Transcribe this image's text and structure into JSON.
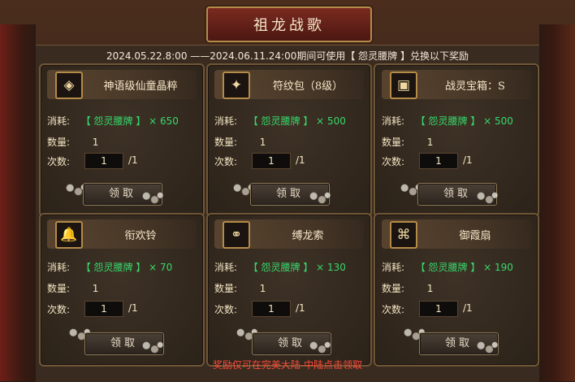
{
  "title": "祖龙战歌",
  "period_text": "2024.05.22.8:00 ——2024.06.11.24:00期间可使用【 怨灵腰牌 】兑换以下奖励",
  "labels": {
    "cost": "消耗:",
    "count": "数量:",
    "times": "次数:",
    "claim": "领取"
  },
  "cards": [
    {
      "name": "神语级仙童晶粹",
      "icon": "crystal-item-icon",
      "cost": "【 怨灵腰牌 】 × 650",
      "count": "1",
      "times_value": "1",
      "times_max": "/1"
    },
    {
      "name": "符纹包（8级）",
      "icon": "rune-bag-icon",
      "cost": "【 怨灵腰牌 】 × 500",
      "count": "1",
      "times_value": "1",
      "times_max": "/1"
    },
    {
      "name": "战灵宝箱：S",
      "icon": "treasure-chest-icon",
      "cost": "【 怨灵腰牌 】 × 500",
      "count": "1",
      "times_value": "1",
      "times_max": "/1"
    },
    {
      "name": "衔欢铃",
      "icon": "bell-icon",
      "cost": "【 怨灵腰牌 】 × 70",
      "count": "1",
      "times_value": "1",
      "times_max": "/1"
    },
    {
      "name": "缚龙索",
      "icon": "rope-icon",
      "cost": "【 怨灵腰牌 】 × 130",
      "count": "1",
      "times_value": "1",
      "times_max": "/1"
    },
    {
      "name": "御霞扇",
      "icon": "fan-icon",
      "cost": "【 怨灵腰牌 】 × 190",
      "count": "1",
      "times_value": "1",
      "times_max": "/1"
    }
  ],
  "footer": "奖励仅可在完美大陆-中陆点击领取",
  "colors": {
    "accent": "#b58a4a",
    "green": "#36d96b",
    "footer_red": "#ff4b3a"
  }
}
